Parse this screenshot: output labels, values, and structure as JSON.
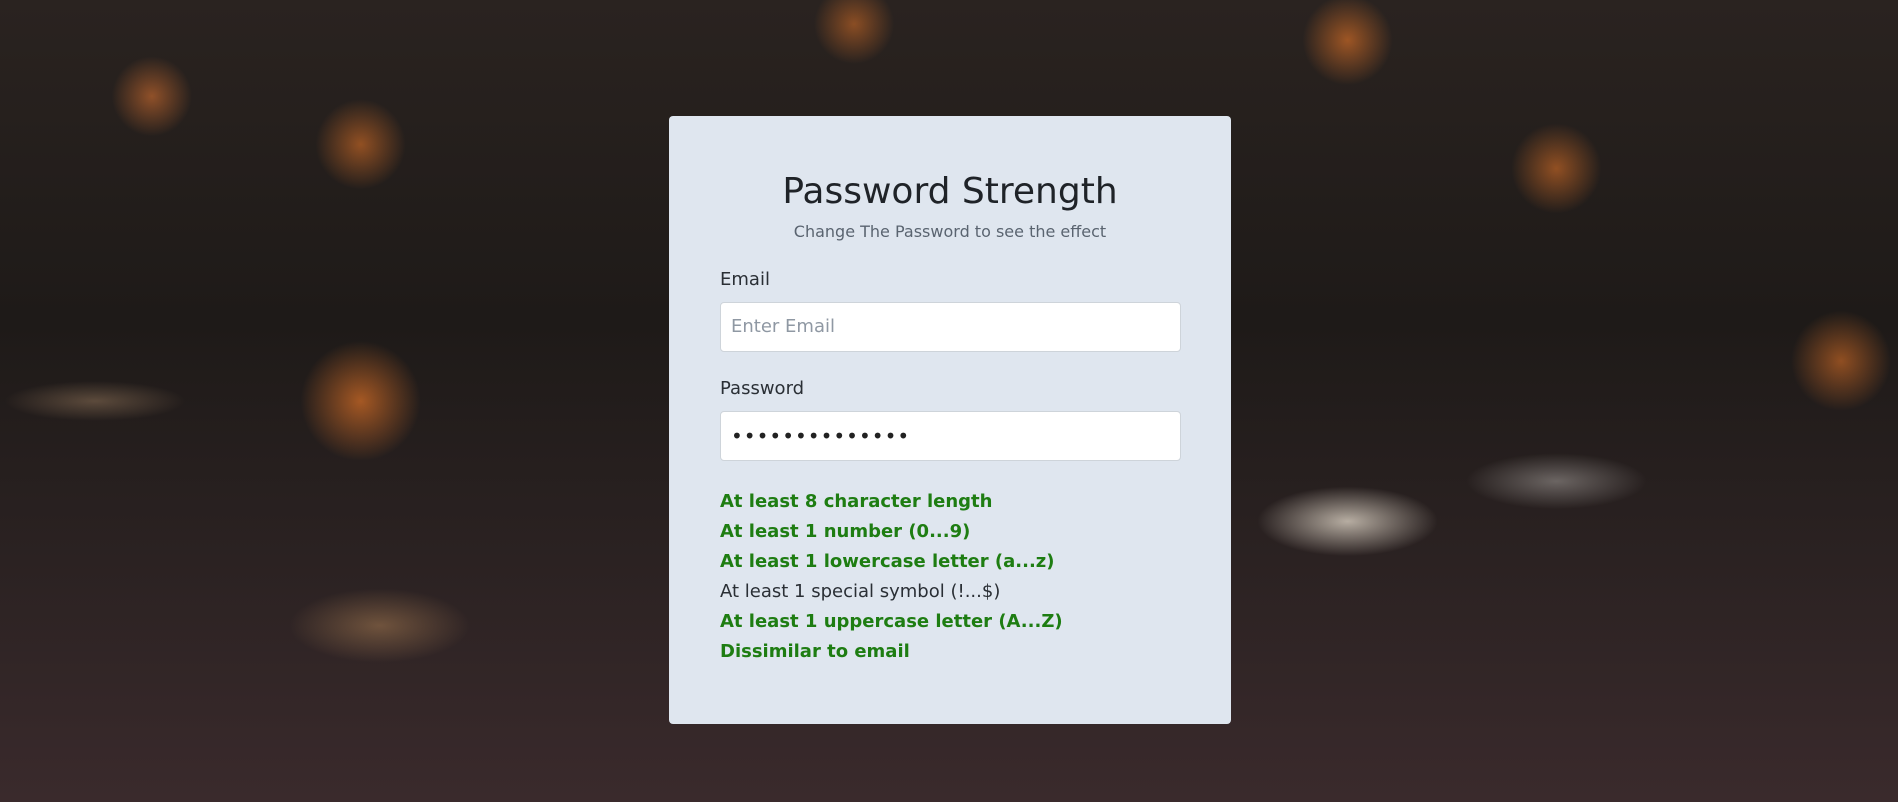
{
  "form": {
    "title": "Password Strength",
    "subtitle": "Change The Password to see the effect",
    "email_label": "Email",
    "email_placeholder": "Enter Email",
    "email_value": "",
    "password_label": "Password",
    "password_value": "••••••••••••••"
  },
  "rules": [
    {
      "text": "At least 8 character length",
      "met": true
    },
    {
      "text": "At least 1 number (0...9)",
      "met": true
    },
    {
      "text": "At least 1 lowercase letter (a...z)",
      "met": true
    },
    {
      "text": "At least 1 special symbol (!...$)",
      "met": false
    },
    {
      "text": "At least 1 uppercase letter (A...Z)",
      "met": true
    },
    {
      "text": "Dissimilar to email",
      "met": true
    }
  ],
  "colors": {
    "card_background": "#dfe6ef",
    "rule_met": "#1e7d12",
    "rule_unmet": "#2a2f35"
  }
}
